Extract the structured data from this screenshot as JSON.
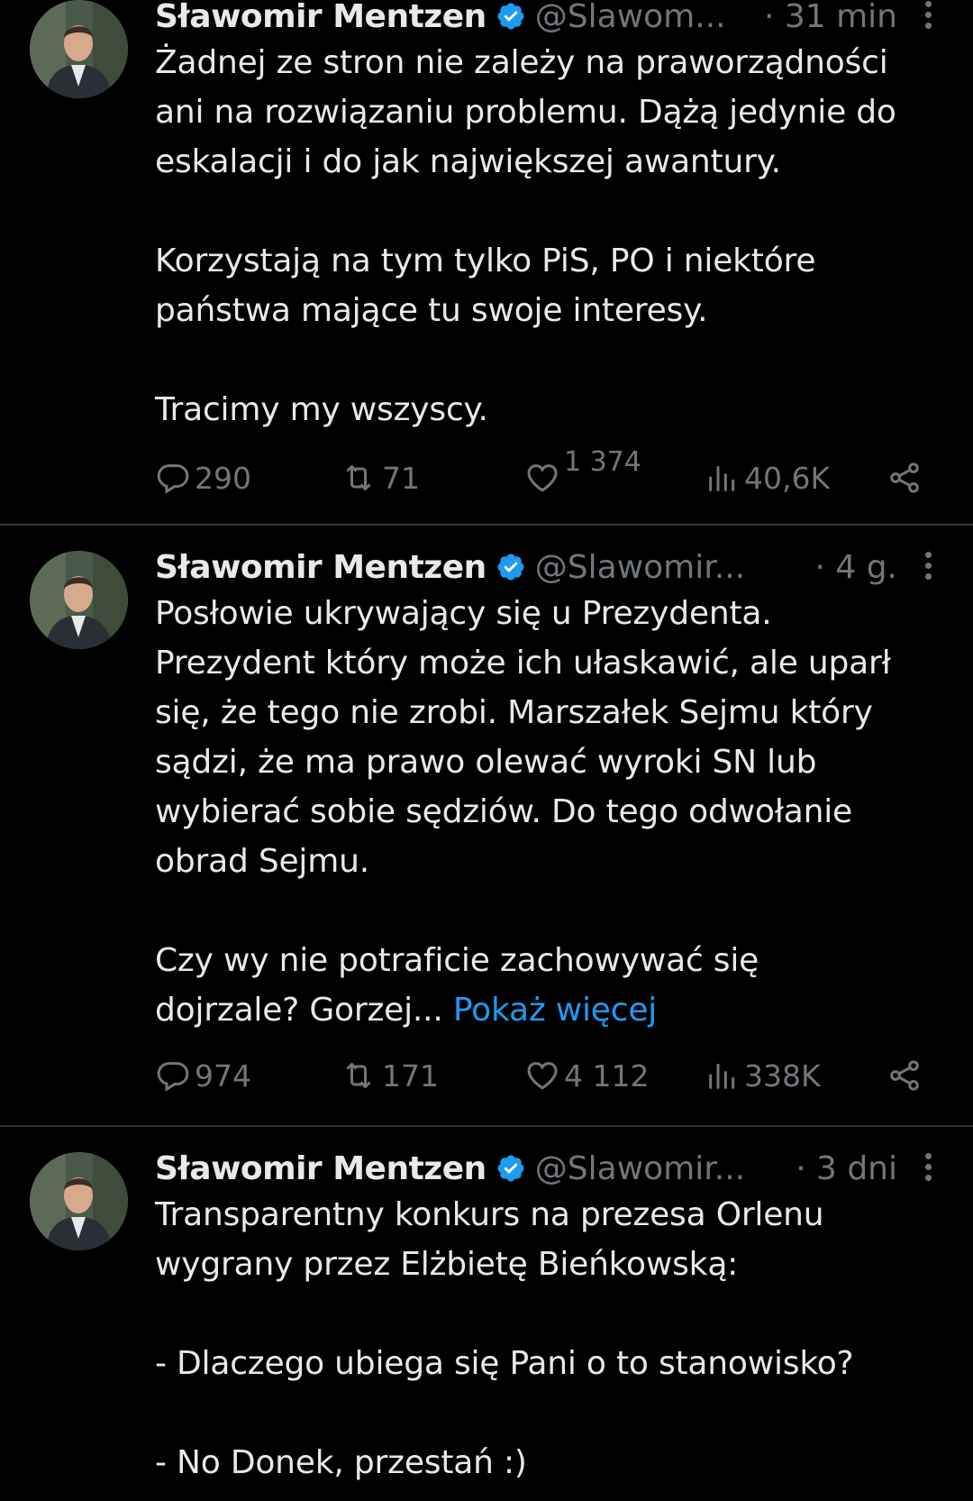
{
  "colors": {
    "background": "#000000",
    "text": "#e7e9ea",
    "muted": "#71767b",
    "link": "#1d9bf0",
    "verified": "#1d9bf0",
    "divider": "#2f3336"
  },
  "icons": {
    "reply": "comment-bubble-icon",
    "retweet": "retweet-icon",
    "like": "heart-icon",
    "views": "bar-chart-icon",
    "share": "share-icon",
    "verified": "verified-badge-icon",
    "more": "vertical-dots-icon"
  },
  "tweets": [
    {
      "name": "Sławomir Mentzen",
      "handle": "@Slawom...",
      "time": "· 31 min",
      "text": "Żadnej ze stron nie zależy na praworządności\nani na rozwiązaniu problemu. Dążą jedynie do\neskalacji i do jak największej awantury.\n\nKorzystają na tym tylko PiS, PO i niektóre\npaństwa mające tu swoje interesy.\n\nTracimy my wszyscy.",
      "show_more": "",
      "replies": "290",
      "retweets": "71",
      "likes": "1 374",
      "views": "40,6K"
    },
    {
      "name": "Sławomir Mentzen",
      "handle": "@Slawomir...",
      "time": "· 4 g.",
      "text": "Posłowie ukrywający się u Prezydenta.\nPrezydent który może ich ułaskawić, ale uparł\nsię, że tego nie zrobi. Marszałek Sejmu który\nsądzi, że ma prawo olewać wyroki SN lub\nwybierać sobie sędziów. Do tego odwołanie\nobrad Sejmu.\n\nCzy wy nie potraficie zachowywać się\ndojrzale? Gorzej... ",
      "show_more": "Pokaż więcej",
      "replies": "974",
      "retweets": "171",
      "likes": "4 112",
      "views": "338K"
    },
    {
      "name": "Sławomir Mentzen",
      "handle": "@Slawomir...",
      "time": "· 3 dni",
      "text": "Transparentny konkurs na prezesa Orlenu\nwygrany przez Elżbietę Bieńkowską:\n\n- Dlaczego ubiega się Pani o to stanowisko?\n\n- No Donek, przestań :)",
      "show_more": "",
      "replies": "",
      "retweets": "",
      "likes": "",
      "views": ""
    }
  ]
}
